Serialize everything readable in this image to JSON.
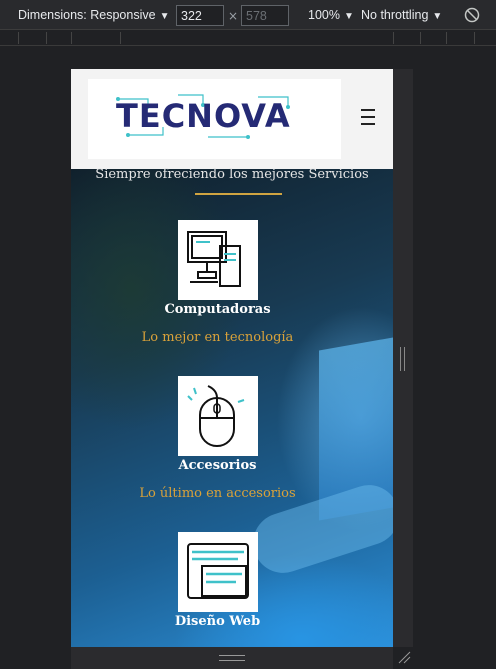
{
  "toolbar": {
    "dimensions_label": "Dimensions: Responsive",
    "width_value": "322",
    "height_value": "578",
    "zoom_label": "100%",
    "throttling_label": "No throttling",
    "caret_icon": "chevron-down-icon",
    "rotate_icon": "rotate-icon"
  },
  "site": {
    "logo_text": "TECNOVA",
    "menu_icon": "hamburger-icon",
    "tagline": "Siempre ofreciendo los mejores Servicios",
    "cards": [
      {
        "icon": "computer-icon",
        "title": "Computadoras",
        "subtitle": "Lo mejor en tecnología"
      },
      {
        "icon": "mouse-icon",
        "title": "Accesorios",
        "subtitle": "Lo último en accesorios"
      },
      {
        "icon": "web-design-icon",
        "title": "Diseño Web",
        "subtitle": ""
      }
    ]
  },
  "colors": {
    "accent_gold": "#d0a441",
    "logo_navy": "#252a75",
    "teal": "#3fc1c9"
  }
}
